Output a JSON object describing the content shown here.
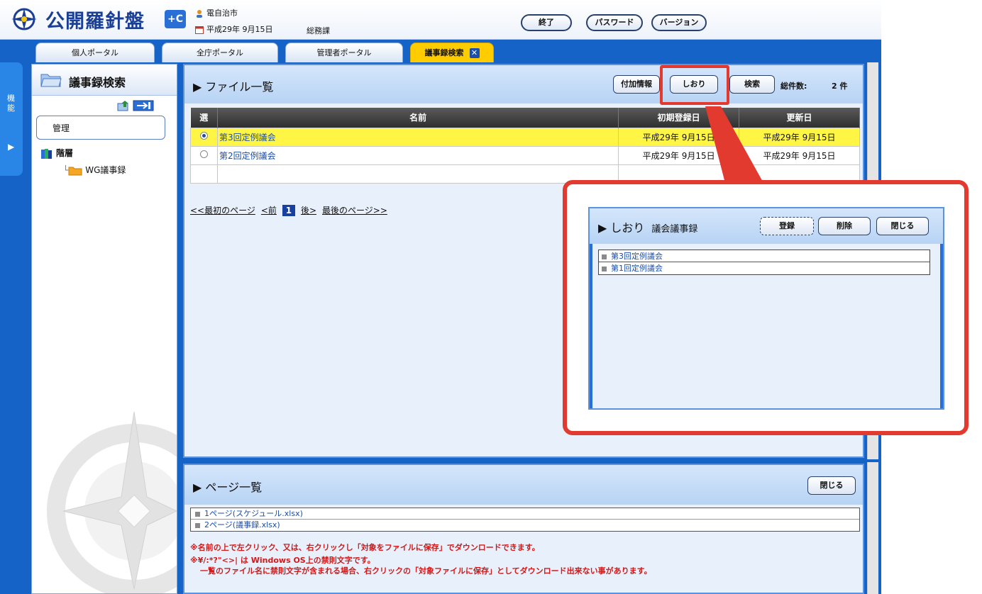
{
  "header": {
    "app_name": "公開羅針盤",
    "app_badge": "+C",
    "user": "電自治市",
    "date": "平成29年 9月15日",
    "department": "総務課",
    "buttons": {
      "end": "終了",
      "password": "パスワード",
      "version": "バージョン"
    }
  },
  "tabs": [
    {
      "label": "個人ポータル"
    },
    {
      "label": "全庁ポータル"
    },
    {
      "label": "管理者ポータル"
    },
    {
      "label": "議事録検索",
      "active": true
    }
  ],
  "side_tab": {
    "label": "機能"
  },
  "sidebar": {
    "title": "議事録検索",
    "management": "管理",
    "tree": [
      {
        "label": "階層"
      },
      {
        "label": "WG議事録"
      }
    ]
  },
  "file_list": {
    "title": "ファイル一覧",
    "buttons": {
      "attached_info": "付加情報",
      "bookmark": "しおり",
      "search": "検索"
    },
    "total_label": "総件数:",
    "total_value": "2 件",
    "columns": [
      "選",
      "名前",
      "初期登録日",
      "更新日"
    ],
    "rows": [
      {
        "name": "第3回定例議会",
        "registered": "平成29年 9月15日",
        "updated": "平成29年 9月15日",
        "selected": true
      },
      {
        "name": "第2回定例議会",
        "registered": "平成29年 9月15日",
        "updated": "平成29年 9月15日",
        "selected": false
      }
    ],
    "pager": {
      "first": "<<最初のページ",
      "prev": "<前",
      "current": "1",
      "next": "後>",
      "last": "最後のページ>>"
    }
  },
  "page_list": {
    "title": "ページ一覧",
    "close": "閉じる",
    "items": [
      "1ページ(スケジュール.xlsx)",
      "2ページ(議事録.xlsx)"
    ],
    "note1": "※名前の上で左クリック、又は、右クリックし「対象をファイルに保存」でダウンロードできます。",
    "note2": "※¥/:*?\"<>| は Windows OS上の禁則文字です。",
    "note3": "一覧のファイル名に禁則文字が含まれる場合、右クリックの「対象ファイルに保存」としてダウンロード出来ない事があります。"
  },
  "bookmark_popup": {
    "title": "しおり",
    "subtitle": "議会議事録",
    "buttons": {
      "register": "登録",
      "delete": "削除",
      "close": "閉じる"
    },
    "items": [
      "第3回定例議会",
      "第1回定例議会"
    ]
  },
  "colors": {
    "frame_blue": "#1663c7",
    "callout_red": "#e23a2e",
    "selected_row": "#fff544",
    "active_tab": "#ffcc00"
  }
}
